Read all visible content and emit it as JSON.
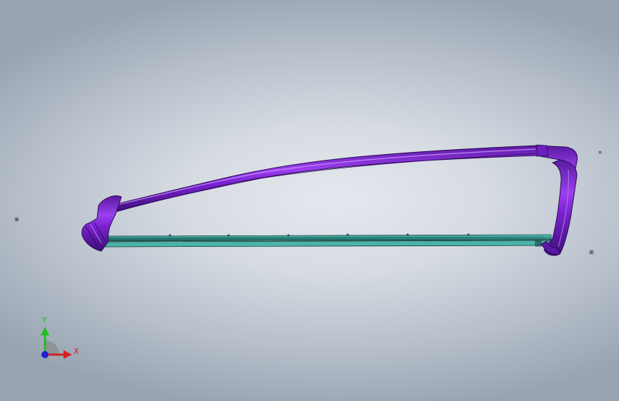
{
  "viewport": {
    "background_center": "#e4e8ee",
    "background_edge": "#98a4b2"
  },
  "model": {
    "name": "hacksaw-assembly",
    "frame_color": "#8a2be2",
    "blade_color": "#3aa39a"
  },
  "triad": {
    "y_label": "Y",
    "x_label": "X",
    "y_color": "#1fbf1f",
    "x_color": "#d42020",
    "z_color": "#2020d4"
  },
  "ref_markers": [
    {
      "glyph": "⊕",
      "name": "origin-marker-left"
    },
    {
      "glyph": "¤",
      "name": "origin-marker-right-top"
    },
    {
      "glyph": "⊞",
      "name": "origin-marker-right-bottom"
    }
  ]
}
